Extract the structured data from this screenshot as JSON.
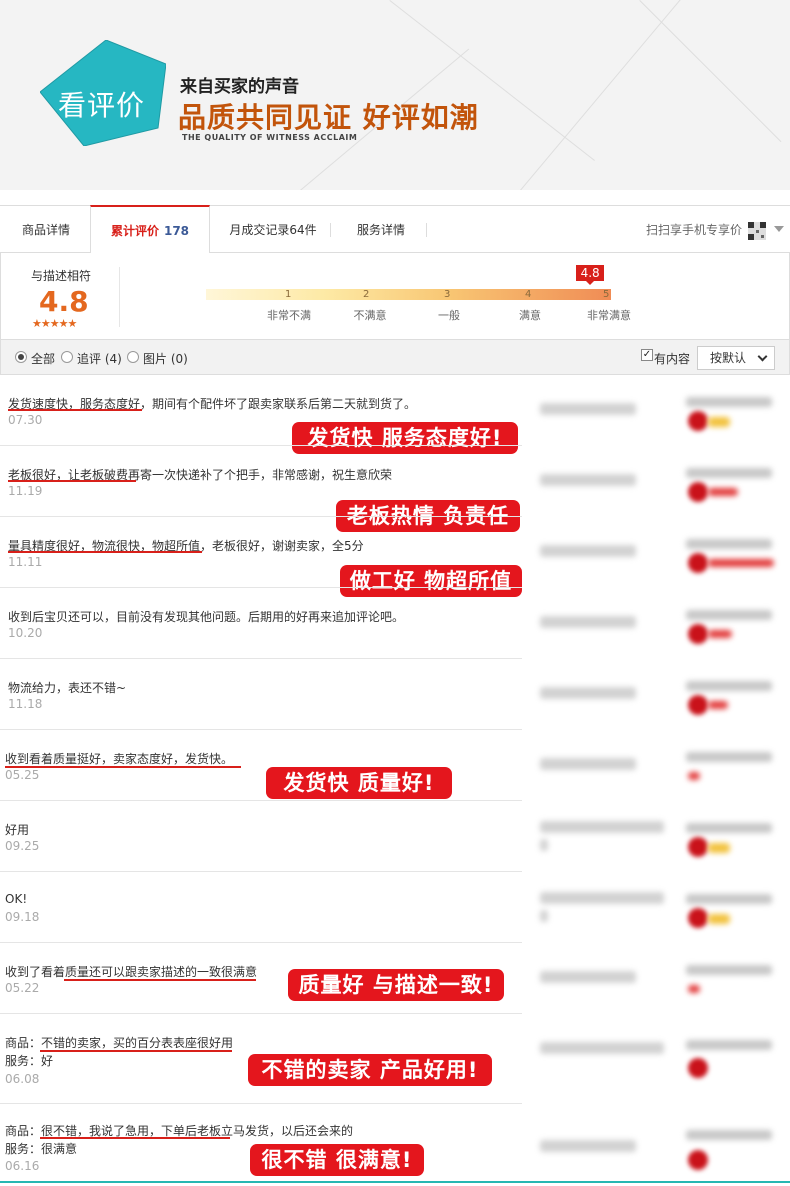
{
  "header": {
    "badge": "看评价",
    "subtitle": "来自买家的声音",
    "title": "品质共同见证  好评如潮",
    "english": "THE QUALITY OF WITNESS ACCLAIM",
    "accent_color": "#26b7c2"
  },
  "tabs": [
    {
      "label": "商品详情",
      "count": ""
    },
    {
      "label": "累计评价",
      "count": "178"
    },
    {
      "label": "月成交记录64件",
      "count": ""
    },
    {
      "label": "服务详情",
      "count": ""
    }
  ],
  "qr": {
    "label": "扫扫享手机专享价",
    "icon": "qr-code-icon"
  },
  "summary": {
    "label": "与描述相符",
    "score": "4.8",
    "stars": "★★★★★",
    "level": 4.8,
    "marker": "4.8",
    "ticks": [
      "1",
      "2",
      "3",
      "4",
      "5"
    ],
    "tick_labels": [
      "非常不满",
      "不满意",
      "一般",
      "满意",
      "非常满意"
    ]
  },
  "filter": {
    "all": "全部",
    "followup": "追评 (4)",
    "pictures": "图片 (0)",
    "has_content": "有内容",
    "has_content_checked": true,
    "sort": "按默认"
  },
  "reviews": [
    {
      "text": "发货速度快，服务态度好，期间有个配件坏了跟卖家联系后第二天就到货了。",
      "date": "07.30",
      "callout": "发货快 服务态度好!"
    },
    {
      "text": "老板很好，让老板破费再寄一次快递补了个把手，非常感谢，祝生意欣荣",
      "date": "11.19",
      "callout": "老板热情 负责任"
    },
    {
      "text": "量具精度很好，物流很快，物超所值，老板很好，谢谢卖家，全5分",
      "date": "11.11",
      "callout": "做工好 物超所值"
    },
    {
      "text": "收到后宝贝还可以，目前没有发现其他问题。后期用的好再来追加评论吧。",
      "date": "10.20",
      "callout": ""
    },
    {
      "text": "物流给力，表还不错~",
      "date": "11.18",
      "callout": ""
    },
    {
      "text": "收到看着质量挺好，卖家态度好，发货快。",
      "date": "05.25",
      "callout": "发货快 质量好!"
    },
    {
      "text": "好用",
      "date": "09.25",
      "callout": ""
    },
    {
      "text": "OK!",
      "date": "09.18",
      "callout": ""
    },
    {
      "text": "收到了看着质量还可以跟卖家描述的一致很满意",
      "date": "05.22",
      "callout": "质量好 与描述一致!"
    },
    {
      "text": "商品：不错的卖家，买的百分表表座很好用",
      "text2": "服务：好",
      "date": "06.08",
      "callout": "不错的卖家 产品好用!"
    },
    {
      "text": "商品：很不错，我说了急用，下单后老板立马发货，以后还会来的",
      "text2": "服务：很满意",
      "date": "06.16",
      "callout": "很不错 很满意!"
    }
  ]
}
